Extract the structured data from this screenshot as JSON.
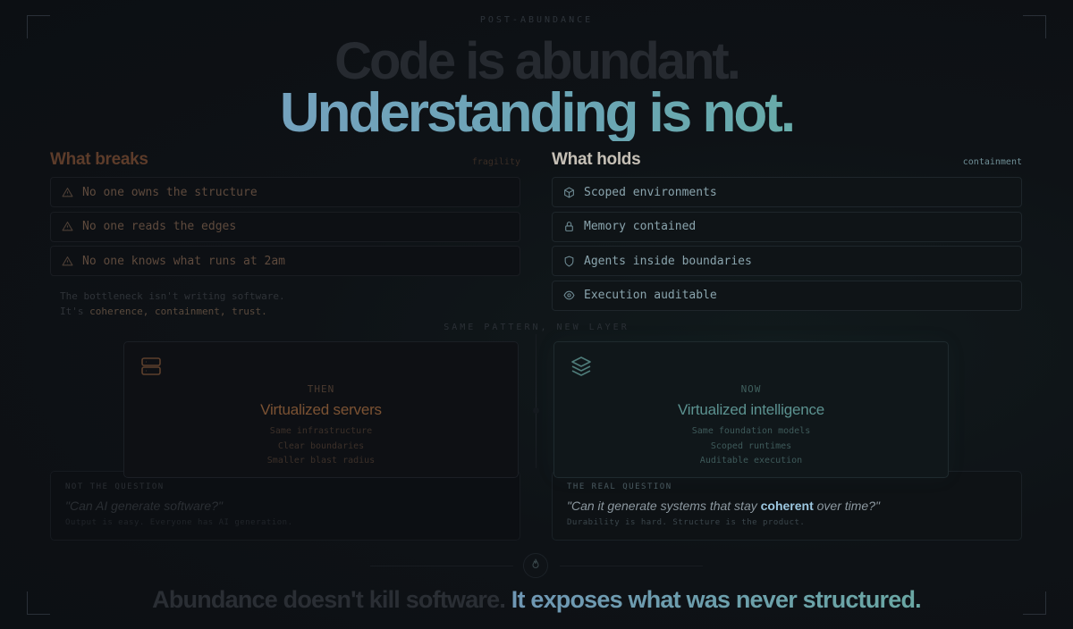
{
  "eyebrow": "POST-ABUNDANCE",
  "headline": {
    "line1": "Code is abundant.",
    "line2": "Understanding is not."
  },
  "breaks": {
    "title": "What breaks",
    "tag": "fragility",
    "items": [
      {
        "icon": "warning-icon",
        "label": "No one owns the structure"
      },
      {
        "icon": "warning-icon",
        "label": "No one reads the edges"
      },
      {
        "icon": "warning-icon",
        "label": "No one knows what runs at 2am"
      }
    ],
    "note_line1": "The bottleneck isn't writing software.",
    "note_prefix": "It's ",
    "note_highlight": "coherence, containment, trust."
  },
  "holds": {
    "title": "What holds",
    "tag": "containment",
    "items": [
      {
        "icon": "cube-icon",
        "label": "Scoped environments"
      },
      {
        "icon": "lock-icon",
        "label": "Memory contained"
      },
      {
        "icon": "shield-icon",
        "label": "Agents inside boundaries"
      },
      {
        "icon": "eye-icon",
        "label": "Execution auditable"
      }
    ]
  },
  "pattern_label": "SAME PATTERN, NEW LAYER",
  "then_card": {
    "icon": "server-icon",
    "tag": "THEN",
    "title": "Virtualized servers",
    "lines": [
      "Same infrastructure",
      "Clear boundaries",
      "Smaller blast radius"
    ]
  },
  "now_card": {
    "icon": "layers-icon",
    "tag": "NOW",
    "title": "Virtualized intelligence",
    "lines": [
      "Same foundation models",
      "Scoped runtimes",
      "Auditable execution"
    ]
  },
  "wrong_question": {
    "label": "NOT THE QUESTION",
    "text": "\"Can AI generate software?\"",
    "sub": "Output is easy. Everyone has AI generation."
  },
  "real_question": {
    "label": "THE REAL QUESTION",
    "text_before": "\"Can it generate systems that stay ",
    "text_highlight": "coherent",
    "text_after": " over time?\"",
    "sub": "Durability is hard. Structure is the product."
  },
  "badge_icon": "flame-icon",
  "closing": {
    "part1": "Abundance doesn't kill software.",
    "part2": "It exposes what was never structured."
  },
  "colors": {
    "warm_accent": "#7b5233",
    "cool_accent": "#5c9290",
    "headline_gradient_start": "#7d9fc6",
    "headline_gradient_end": "#64b49b",
    "background": "#0d1015"
  }
}
